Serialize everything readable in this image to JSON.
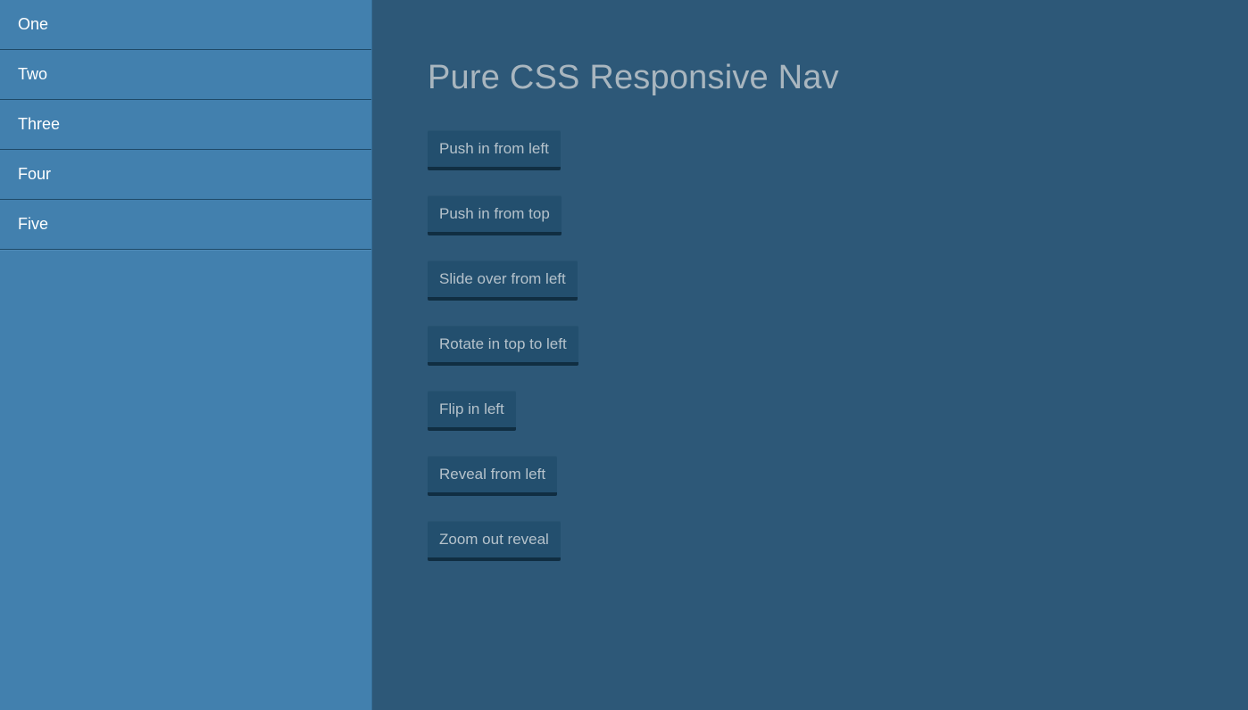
{
  "sidebar": {
    "items": [
      {
        "label": "One"
      },
      {
        "label": "Two"
      },
      {
        "label": "Three"
      },
      {
        "label": "Four"
      },
      {
        "label": "Five"
      }
    ],
    "background_color": "#4280ae",
    "divider_color": "#1f4a68",
    "text_color": "#ffffff"
  },
  "main": {
    "title": "Pure CSS Responsive Nav",
    "title_color": "#a9b6bf",
    "background_color": "#2d5878",
    "buttons": [
      {
        "label": "Push in from left"
      },
      {
        "label": "Push in from top"
      },
      {
        "label": "Slide over from left"
      },
      {
        "label": "Rotate in top to left"
      },
      {
        "label": "Flip in left"
      },
      {
        "label": "Reveal from left"
      },
      {
        "label": "Zoom out reveal"
      }
    ],
    "button_face_color": "#234f6e",
    "button_border_color": "#102e42",
    "button_text_color": "#b5c2cb"
  }
}
